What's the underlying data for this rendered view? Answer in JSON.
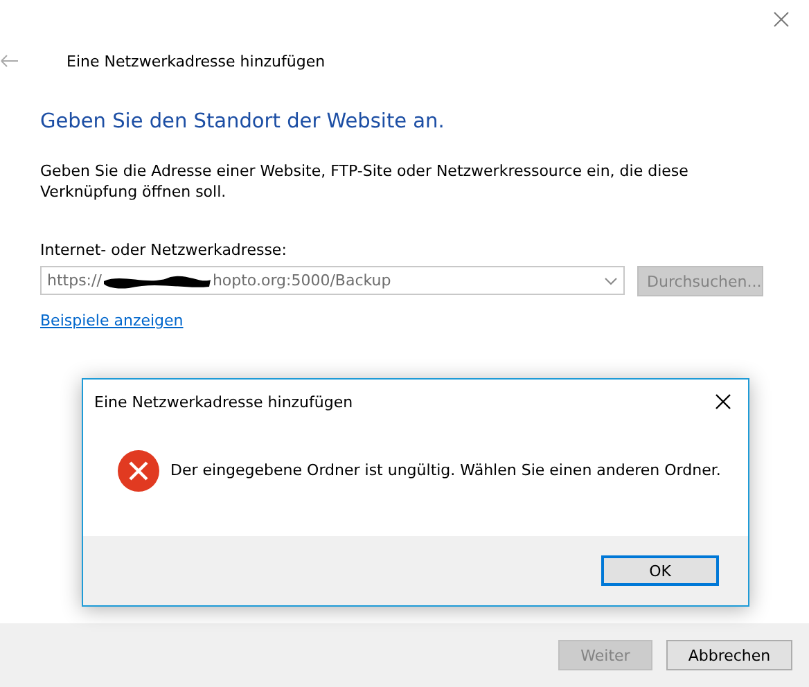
{
  "window": {
    "title": "Eine Netzwerkadresse hinzufügen"
  },
  "heading": "Geben Sie den Standort der Website an.",
  "description": "Geben Sie die Adresse einer Website, FTP-Site oder Netzwerkressource ein, die diese Verknüpfung öffnen soll.",
  "address": {
    "label": "Internet- oder Netzwerkadresse:",
    "value_start": "https://",
    "redacted": true,
    "value_end": "hopto.org:5000/Backup"
  },
  "browse_button": {
    "label": "Durchsuchen...",
    "disabled": true
  },
  "examples_link": "Beispiele anzeigen",
  "footer_buttons": [
    {
      "label": "Weiter",
      "disabled": true
    },
    {
      "label": "Abbrechen",
      "disabled": false
    }
  ],
  "dialog": {
    "title": "Eine Netzwerkadresse hinzufügen",
    "message": "Der eingegebene Ordner ist ungültig. Wählen Sie einen anderen Ordner.",
    "button": "OK"
  }
}
